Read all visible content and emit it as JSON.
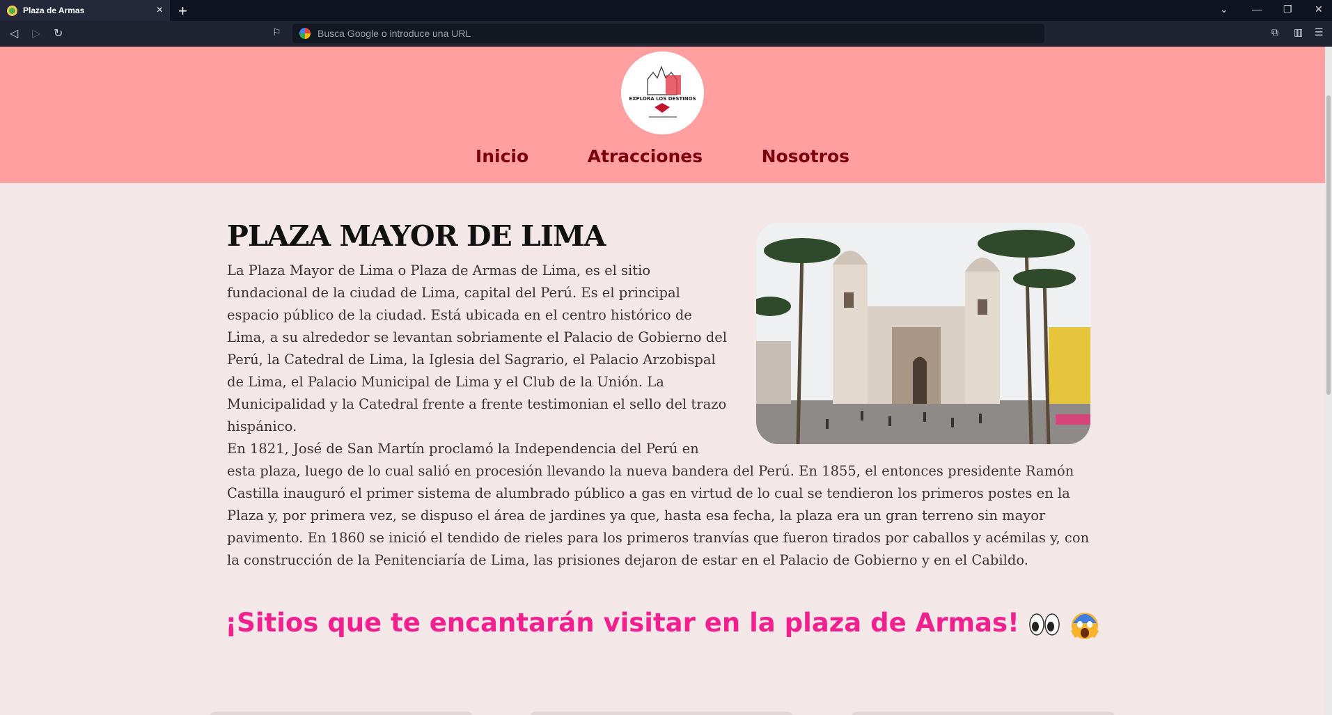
{
  "browser": {
    "tab_title": "Plaza de Armas",
    "new_tab": "+",
    "close_tab": "×",
    "window_controls": [
      "⌄",
      "—",
      "❐",
      "✕"
    ],
    "url_placeholder": "Busca Google o introduce una URL"
  },
  "site": {
    "nav": [
      "Inicio",
      "Atracciones",
      "Nosotros"
    ],
    "logo_text": "EXPLORA LOS DESTINOS"
  },
  "article": {
    "title": "PLAZA MAYOR DE LIMA",
    "paragraph1": "La Plaza Mayor de Lima o Plaza de Armas de Lima, es el sitio fundacional de la ciudad de Lima, capital del Perú. Es el principal espacio público de la ciudad. Está ubicada en el centro histórico de Lima, a su alrededor se levantan sobriamente el Palacio de Gobierno del Perú, la Catedral de Lima, la Iglesia del Sagrario, el Palacio Arzobispal de Lima, el Palacio Municipal de Lima y el Club de la Unión. La Municipalidad y la Catedral frente a frente testimonian el sello del trazo hispánico.",
    "paragraph2": "En 1821, José de San Martín proclamó la Independencia del Perú en esta plaza, luego de lo cual salió en procesión llevando la nueva bandera del Perú. En 1855, el entonces presidente Ramón Castilla inauguró el primer sistema de alumbrado público a gas en virtud de lo cual se tendieron los primeros postes en la Plaza y, por primera vez, se dispuso el área de jardines ya que, hasta esa fecha, la plaza era un gran terreno sin mayor pavimento. En 1860 se inició el tendido de rieles para los primeros tranvías que fueron tirados por caballos y acémilas y, con la construcción de la Penitenciaría de Lima, las prisiones dejaron de estar en el Palacio de Gobierno y en el Cabildo."
  },
  "sites_heading": "¡Sitios que te encantarán visitar en la plaza de Armas!",
  "colors": {
    "header_bg": "#ff9f9f",
    "nav_text": "#7b0010",
    "heading_pink": "#f0208f",
    "page_bg": "#f3e7e7"
  }
}
